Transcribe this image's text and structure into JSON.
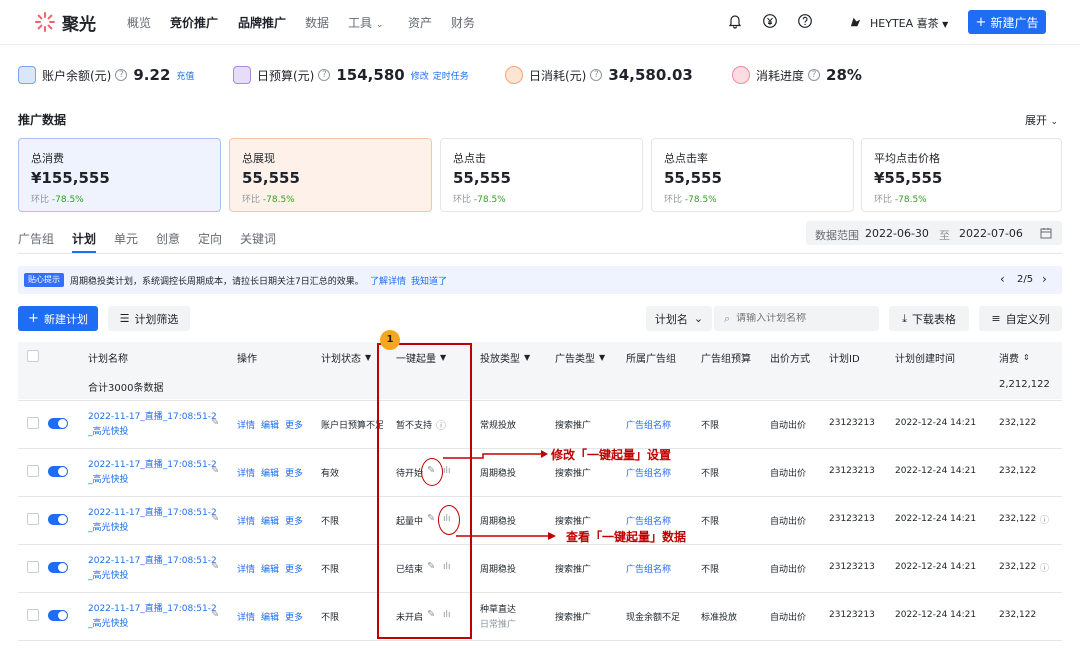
{
  "app": {
    "name": "聚光"
  },
  "nav": {
    "items": [
      "概览",
      "竞价推广",
      "品牌推广",
      "数据",
      "工具",
      "资产",
      "财务"
    ],
    "account": "HEYTEA 喜茶",
    "new_ad": "新建广告"
  },
  "stats": {
    "balance": {
      "label": "账户余额(元)",
      "value": "9.22",
      "link": "充值"
    },
    "daily_budget": {
      "label": "日预算(元)",
      "value": "154,580",
      "link1": "修改",
      "link2": "定时任务"
    },
    "daily_spend": {
      "label": "日消耗(元)",
      "value": "34,580.03"
    },
    "progress": {
      "label": "消耗进度",
      "value": "28%"
    }
  },
  "promo": {
    "title": "推广数据",
    "expand": "展开",
    "cards": [
      {
        "label": "总消费",
        "value": "¥155,555",
        "cmp_label": "环比",
        "cmp": "-78.5%"
      },
      {
        "label": "总展现",
        "value": "55,555",
        "cmp_label": "环比",
        "cmp": "-78.5%"
      },
      {
        "label": "总点击",
        "value": "55,555",
        "cmp_label": "环比",
        "cmp": "-78.5%"
      },
      {
        "label": "总点击率",
        "value": "55,555",
        "cmp_label": "环比",
        "cmp": "-78.5%"
      },
      {
        "label": "平均点击价格",
        "value": "¥55,555",
        "cmp_label": "环比",
        "cmp": "-78.5%"
      }
    ]
  },
  "tabs": [
    "广告组",
    "计划",
    "单元",
    "创意",
    "定向",
    "关键词"
  ],
  "date_range": {
    "label": "数据范围",
    "start": "2022-06-30",
    "sep": "至",
    "end": "2022-07-06"
  },
  "notice": {
    "tag": "贴心提示",
    "text": "周期稳投类计划，系统调控长周期成本，请拉长日期关注7日汇总的效果。",
    "link1": "了解详情",
    "link2": "我知道了",
    "page": "2/5"
  },
  "toolbar": {
    "new_plan": "新建计划",
    "filter": "计划筛选",
    "select": "计划名",
    "search_placeholder": "请输入计划名称",
    "download": "下载表格",
    "custom_cols": "自定义列"
  },
  "table": {
    "headers": [
      "计划名称",
      "操作",
      "计划状态",
      "一键起量",
      "投放类型",
      "广告类型",
      "所属广告组",
      "广告组预算",
      "出价方式",
      "计划ID",
      "计划创建时间",
      "消费"
    ],
    "summary": {
      "label": "合计3000条数据",
      "total": "2,212,122"
    },
    "actions": [
      "详情",
      "编辑",
      "更多"
    ],
    "rows": [
      {
        "name1": "2022-11-17_直播_17:08:51-2",
        "name2": "_高光快投",
        "status": "账户日预算不足",
        "boost": "暂不支持",
        "type": "常规投放",
        "type2": "",
        "ad_type": "搜索推广",
        "group": "广告组名称",
        "budget": "不限",
        "bid": "自动出价",
        "id": "23123213",
        "time": "2022-12-24 14:21",
        "spend": "232,122"
      },
      {
        "name1": "2022-11-17_直播_17:08:51-2",
        "name2": "_高光快投",
        "status": "有效",
        "boost": "待开始",
        "type": "周期稳投",
        "type2": "",
        "ad_type": "搜索推广",
        "group": "广告组名称",
        "budget": "不限",
        "bid": "自动出价",
        "id": "23123213",
        "time": "2022-12-24 14:21",
        "spend": "232,122"
      },
      {
        "name1": "2022-11-17_直播_17:08:51-2",
        "name2": "_高光快投",
        "status": "不限",
        "boost": "起量中",
        "type": "周期稳投",
        "type2": "",
        "ad_type": "搜索推广",
        "group": "广告组名称",
        "budget": "不限",
        "bid": "自动出价",
        "id": "23123213",
        "time": "2022-12-24 14:21",
        "spend": "232,122"
      },
      {
        "name1": "2022-11-17_直播_17:08:51-2",
        "name2": "_高光快投",
        "status": "不限",
        "boost": "已结束",
        "type": "周期稳投",
        "type2": "",
        "ad_type": "搜索推广",
        "group": "广告组名称",
        "budget": "不限",
        "bid": "自动出价",
        "id": "23123213",
        "time": "2022-12-24 14:21",
        "spend": "232,122"
      },
      {
        "name1": "2022-11-17_直播_17:08:51-2",
        "name2": "_高光快投",
        "status": "不限",
        "boost": "未开启",
        "type": "种草直达",
        "type2": "日常推广",
        "ad_type": "搜索推广",
        "group": "现金余额不足",
        "budget": "标准投放",
        "bid": "自动出价",
        "id": "23123213",
        "time": "2022-12-24 14:21",
        "spend": "232,122"
      }
    ]
  },
  "annotations": {
    "badge": "1",
    "edit_note": "修改「一键起量」设置",
    "view_note": "查看「一键起量」数据"
  },
  "colors": {
    "primary": "#1f6df5",
    "annotation": "#c00000",
    "positive": "#2ea121"
  }
}
